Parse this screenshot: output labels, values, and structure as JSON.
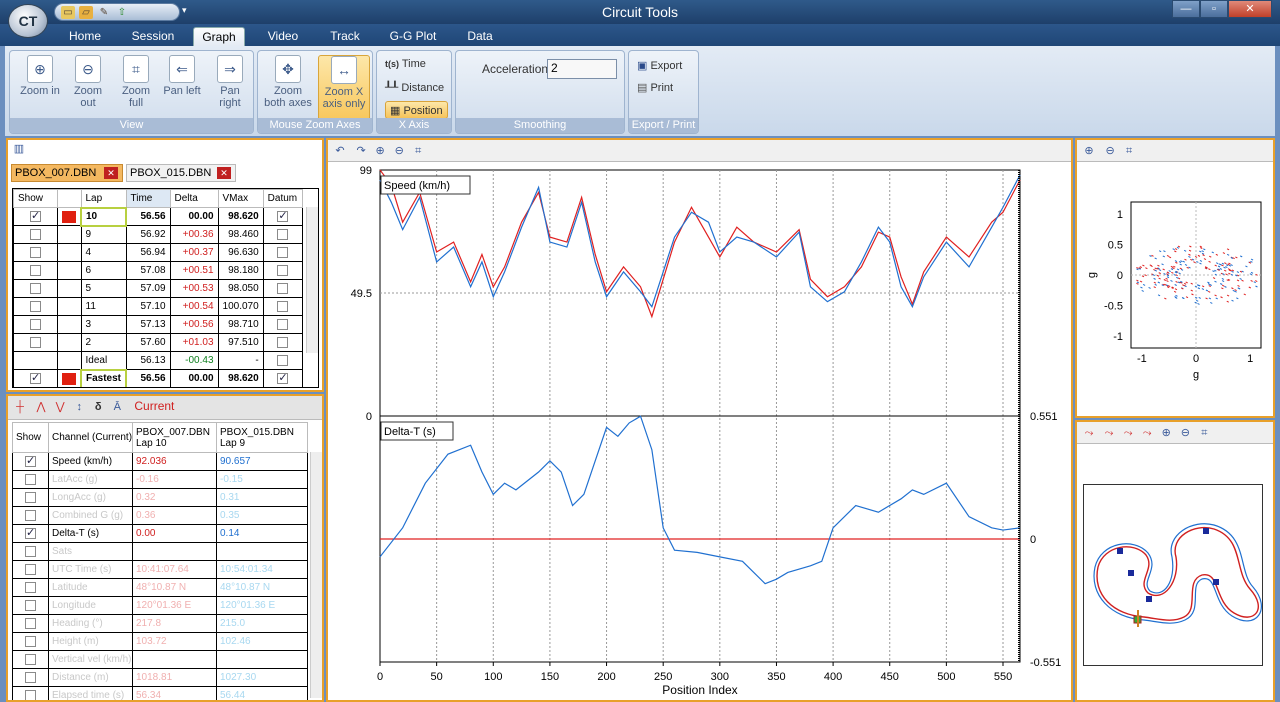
{
  "app": {
    "title": "Circuit Tools",
    "logo": "CT"
  },
  "quick_access": [
    "folder-icon",
    "folder-open-icon",
    "tools-icon",
    "export-icon"
  ],
  "tabs": [
    "Home",
    "Session",
    "Graph",
    "Video",
    "Track",
    "G-G Plot",
    "Data"
  ],
  "active_tab": "Graph",
  "ribbon": {
    "view": {
      "label": "View",
      "buttons": [
        "Zoom in",
        "Zoom out",
        "Zoom full",
        "Pan left",
        "Pan right"
      ]
    },
    "mouse_zoom": {
      "label": "Mouse Zoom Axes",
      "buttons": [
        "Zoom both axes",
        "Zoom X axis only"
      ],
      "selected": "Zoom X axis only"
    },
    "x_axis": {
      "label": "X Axis",
      "options": [
        "Time",
        "Distance",
        "Position"
      ],
      "time_prefix": "t(s)",
      "selected": "Position"
    },
    "smoothing": {
      "label": "Smoothing",
      "acc_label": "Acceleration",
      "acc_value": "2"
    },
    "export": {
      "label": "Export / Print",
      "buttons": [
        "Export",
        "Print"
      ]
    }
  },
  "files": [
    "PBOX_007.DBN",
    "PBOX_015.DBN"
  ],
  "lap_table": {
    "headers": [
      "Show",
      "Lap",
      "Time",
      "Delta",
      "VMax",
      "Datum"
    ],
    "rows": [
      {
        "show": true,
        "color": "#e02010",
        "lap": "10",
        "time": "56.56",
        "delta": "00.00",
        "vmax": "98.620",
        "datum": true
      },
      {
        "show": false,
        "lap": "9",
        "time": "56.92",
        "delta": "+00.36",
        "vmax": "98.460",
        "datum": false
      },
      {
        "show": false,
        "lap": "4",
        "time": "56.94",
        "delta": "+00.37",
        "vmax": "96.630",
        "datum": false
      },
      {
        "show": false,
        "lap": "6",
        "time": "57.08",
        "delta": "+00.51",
        "vmax": "98.180",
        "datum": false
      },
      {
        "show": false,
        "lap": "5",
        "time": "57.09",
        "delta": "+00.53",
        "vmax": "98.050",
        "datum": false
      },
      {
        "show": false,
        "lap": "11",
        "time": "57.10",
        "delta": "+00.54",
        "vmax": "100.070",
        "datum": false
      },
      {
        "show": false,
        "lap": "3",
        "time": "57.13",
        "delta": "+00.56",
        "vmax": "98.710",
        "datum": false
      },
      {
        "show": false,
        "lap": "2",
        "time": "57.60",
        "delta": "+01.03",
        "vmax": "97.510",
        "datum": false
      }
    ],
    "ideal": {
      "lap": "Ideal",
      "time": "56.13",
      "delta": "-00.43",
      "vmax": "-"
    },
    "fastest": {
      "lap": "Fastest",
      "time": "56.56",
      "delta": "00.00",
      "vmax": "98.620"
    }
  },
  "channel_toolbar": {
    "current_label": "Current"
  },
  "channel_table": {
    "headers": [
      "Show",
      "Channel (Current)",
      "PBOX_007.DBN Lap 10",
      "PBOX_015.DBN Lap 9"
    ],
    "rows": [
      {
        "show": true,
        "name": "Speed (km/h)",
        "v1": "92.036",
        "v2": "90.657",
        "active": true
      },
      {
        "show": false,
        "name": "LatAcc (g)",
        "v1": "-0.16",
        "v2": "-0.15",
        "active": false
      },
      {
        "show": false,
        "name": "LongAcc (g)",
        "v1": "0.32",
        "v2": "0.31",
        "active": false
      },
      {
        "show": false,
        "name": "Combined G (g)",
        "v1": "0.36",
        "v2": "0.35",
        "active": false
      },
      {
        "show": true,
        "name": "Delta-T (s)",
        "v1": "0.00",
        "v2": "0.14",
        "active": true
      },
      {
        "show": false,
        "name": "Sats",
        "v1": "",
        "v2": "",
        "active": false
      },
      {
        "show": false,
        "name": "UTC Time (s)",
        "v1": "10:41:07.64",
        "v2": "10:54:01.34",
        "active": false
      },
      {
        "show": false,
        "name": "Latitude",
        "v1": "48°10.87 N",
        "v2": "48°10.87 N",
        "active": false
      },
      {
        "show": false,
        "name": "Longitude",
        "v1": "120°01.36 E",
        "v2": "120°01.36 E",
        "active": false
      },
      {
        "show": false,
        "name": "Heading (°)",
        "v1": "217.8",
        "v2": "215.0",
        "active": false
      },
      {
        "show": false,
        "name": "Height (m)",
        "v1": "103.72",
        "v2": "102.46",
        "active": false
      },
      {
        "show": false,
        "name": "Vertical vel (km/h)",
        "v1": "",
        "v2": "",
        "active": false
      },
      {
        "show": false,
        "name": "Distance (m)",
        "v1": "1018.81",
        "v2": "1027.30",
        "active": false
      },
      {
        "show": false,
        "name": "Elapsed time (s)",
        "v1": "56.34",
        "v2": "56.44",
        "active": false
      }
    ]
  },
  "chart_data": [
    {
      "type": "line",
      "title": "Speed (km/h)",
      "xlabel": "Position Index",
      "ylim": [
        0,
        99
      ],
      "y_ticks": [
        "99",
        "49.5",
        "0"
      ],
      "x_ticks": [
        "0",
        "50",
        "100",
        "150",
        "200",
        "250",
        "300",
        "350",
        "400",
        "450",
        "500",
        "550"
      ],
      "xlim": [
        0,
        565
      ],
      "series": [
        {
          "name": "",
          "color": "#e02020",
          "x": [
            0,
            10,
            20,
            35,
            50,
            65,
            80,
            90,
            100,
            110,
            125,
            140,
            150,
            165,
            178,
            190,
            200,
            215,
            230,
            240,
            250,
            260,
            275,
            290,
            300,
            315,
            330,
            350,
            370,
            380,
            395,
            410,
            425,
            440,
            450,
            460,
            470,
            480,
            500,
            520,
            540,
            550,
            565
          ],
          "y": [
            99,
            93,
            78,
            90,
            66,
            70,
            54,
            65,
            52,
            60,
            78,
            90,
            72,
            70,
            88,
            65,
            50,
            60,
            52,
            40,
            55,
            70,
            84,
            72,
            64,
            76,
            70,
            66,
            75,
            55,
            48,
            52,
            60,
            74,
            72,
            56,
            45,
            58,
            72,
            64,
            78,
            82,
            95
          ]
        },
        {
          "name": "",
          "color": "#2070d0",
          "x": [
            0,
            10,
            20,
            35,
            50,
            65,
            80,
            90,
            100,
            110,
            125,
            140,
            150,
            165,
            178,
            190,
            200,
            215,
            230,
            240,
            250,
            260,
            275,
            290,
            300,
            315,
            330,
            350,
            370,
            380,
            395,
            410,
            425,
            440,
            450,
            460,
            470,
            480,
            500,
            520,
            540,
            550,
            565
          ],
          "y": [
            95,
            86,
            75,
            88,
            62,
            68,
            52,
            62,
            48,
            58,
            76,
            92,
            70,
            68,
            86,
            62,
            48,
            58,
            50,
            44,
            58,
            72,
            82,
            78,
            66,
            72,
            70,
            64,
            74,
            52,
            46,
            50,
            62,
            76,
            70,
            52,
            44,
            56,
            70,
            60,
            76,
            84,
            97
          ]
        }
      ]
    },
    {
      "type": "line",
      "title": "Delta-T (s)",
      "xlabel": "Position Index",
      "ylim": [
        -0.551,
        0.551
      ],
      "y_ticks": [
        "0.551",
        "0",
        "-0.551"
      ],
      "xlim": [
        0,
        565
      ],
      "series": [
        {
          "name": "",
          "color": "#e02020",
          "x": [
            0,
            565
          ],
          "y": [
            0,
            0
          ]
        },
        {
          "name": "",
          "color": "#2070d0",
          "x": [
            0,
            20,
            40,
            60,
            80,
            90,
            100,
            110,
            120,
            140,
            150,
            160,
            170,
            180,
            190,
            200,
            210,
            220,
            230,
            240,
            250,
            260,
            280,
            300,
            320,
            340,
            350,
            360,
            380,
            390,
            400,
            420,
            440,
            460,
            470,
            480,
            500,
            520,
            540,
            550,
            565
          ],
          "y": [
            -0.08,
            0.05,
            0.25,
            0.38,
            0.42,
            0.3,
            0.2,
            0.25,
            0.22,
            0.3,
            0.35,
            0.3,
            0.15,
            0.2,
            0.35,
            0.5,
            0.46,
            0.52,
            0.55,
            0.4,
            0.05,
            -0.05,
            -0.06,
            -0.08,
            -0.1,
            -0.2,
            -0.18,
            -0.15,
            -0.12,
            -0.1,
            0.05,
            0.15,
            0.12,
            0.18,
            0.22,
            0.2,
            0.25,
            0.1,
            0.05,
            0.04,
            0.05
          ]
        }
      ]
    },
    {
      "type": "scatter",
      "title": "",
      "xlabel": "g",
      "ylabel": "g",
      "xlim": [
        -1.2,
        1.2
      ],
      "ylim": [
        -1.2,
        1.2
      ],
      "x_ticks": [
        "-1",
        "0",
        "1"
      ],
      "y_ticks": [
        "1",
        "0.5",
        "0",
        "-0.5",
        "-1"
      ]
    }
  ],
  "colors": {
    "accent": "#e8a02a",
    "lap1": "#e02020",
    "lap2": "#2070d0"
  }
}
